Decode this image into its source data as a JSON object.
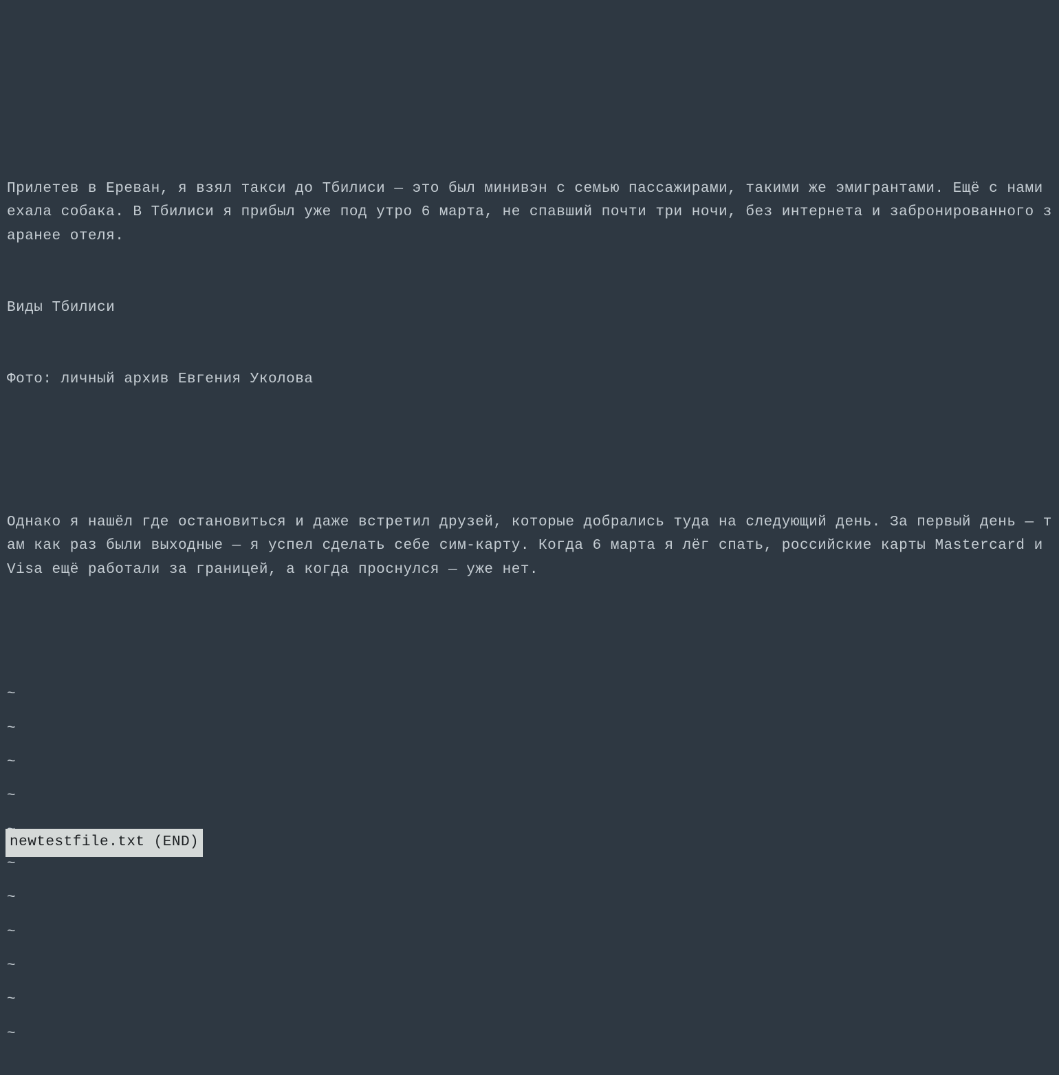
{
  "content": {
    "paragraph1": "Прилетев в Ереван, я взял такси до Тбилиси — это был минивэн с семью пассажирами, такими же эмигрантами. Ещё с нами ехала собака. В Тбилиси я прибыл уже под утро 6 марта, не спавший почти три ночи, без интернета и забронированного заранее отеля.",
    "caption_heading": "Виды Тбилиси",
    "caption_credit": "Фото: личный архив Евгения Уколова",
    "paragraph2": "Однако я нашёл где остановиться и даже встретил друзей, которые добрались туда на следующий день. За первый день — там как раз были выходные — я успел сделать себе сим-карту. Когда 6 марта я лёг спать, российские карты Mastercard и Visa ещё работали за границей, а когда проснулся — уже нет."
  },
  "tilde": "~",
  "tilde_count": 11,
  "status": {
    "filename": "newtestfile.txt",
    "position": "(END)"
  }
}
